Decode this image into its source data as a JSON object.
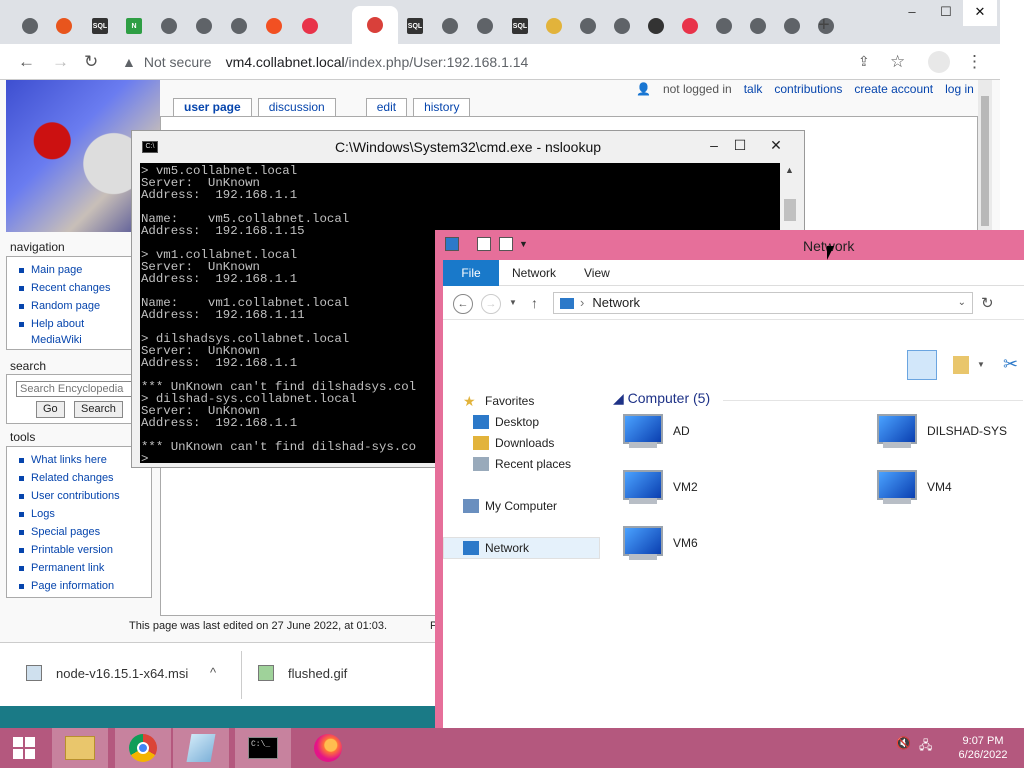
{
  "browser": {
    "tabs": [
      {
        "icon": "chrome-icon",
        "color": "#5f6368"
      },
      {
        "icon": "red-circle-icon",
        "color": "#e8551d"
      },
      {
        "icon": "sql-server-icon",
        "color": "#333333",
        "text": "SQL"
      },
      {
        "icon": "n-icon",
        "color": "#2e9e44",
        "text": "N"
      },
      {
        "icon": "download-icon",
        "color": "#5f6368"
      },
      {
        "icon": "chrome-icon",
        "color": "#5f6368"
      },
      {
        "icon": "chrome-icon",
        "color": "#5f6368"
      },
      {
        "icon": "windows-logo-icon",
        "color": "#f25022"
      },
      {
        "icon": "opera-icon",
        "color": "#e8334a"
      },
      {
        "icon": "calendar-icon",
        "color": "#d9403a"
      },
      {
        "icon": "sql-server-icon",
        "color": "#333333",
        "text": "SQL"
      },
      {
        "icon": "chrome-icon",
        "color": "#5f6368"
      },
      {
        "icon": "diamond-icon",
        "color": "#5f6368"
      },
      {
        "icon": "sql-server-icon",
        "color": "#333333",
        "text": "SQL"
      },
      {
        "icon": "folder-icon",
        "color": "#e2b33b"
      },
      {
        "icon": "gear-icon",
        "color": "#5f6368"
      },
      {
        "icon": "chrome-icon",
        "color": "#5f6368"
      },
      {
        "icon": "wikipedia-icon",
        "color": "#333333"
      },
      {
        "icon": "opera-icon",
        "color": "#e8334a"
      },
      {
        "icon": "chrome-icon",
        "color": "#5f6368"
      },
      {
        "icon": "chrome-icon",
        "color": "#5f6368"
      },
      {
        "icon": "gear-icon",
        "color": "#5f6368"
      },
      {
        "icon": "chrome-icon",
        "color": "#5f6368"
      }
    ],
    "new_tab": "+",
    "window_controls": {
      "minimize": "–",
      "maximize": "☐",
      "close": "✕"
    },
    "address": {
      "security": "Not secure",
      "host": "vm4.collabnet.local",
      "path": "/index.php/User:192.168.1.14"
    }
  },
  "wiki": {
    "personal": [
      "not logged in",
      "talk",
      "contributions",
      "create account",
      "log in"
    ],
    "tabs": [
      "user page",
      "discussion",
      "edit",
      "history"
    ],
    "navigation": {
      "heading": "navigation",
      "items": [
        "Main page",
        "Recent changes",
        "Random page",
        "Help about",
        "MediaWiki"
      ]
    },
    "search": {
      "heading": "search",
      "placeholder": "Search Encyclopedia",
      "go": "Go",
      "search": "Search"
    },
    "tools": {
      "heading": "tools",
      "items": [
        "What links here",
        "Related changes",
        "User contributions",
        "Logs",
        "Special pages",
        "Printable version",
        "Permanent link",
        "Page information"
      ]
    },
    "footer": "This page was last edited on 27 June 2022, at 01:03.",
    "footer_cut": "P"
  },
  "downloads": [
    {
      "name": "node-v16.15.1-x64.msi"
    },
    {
      "name": "flushed.gif"
    }
  ],
  "cmd": {
    "title": "C:\\Windows\\System32\\cmd.exe - nslookup",
    "icon_text": "C:\\",
    "lines": [
      "> vm5.collabnet.local",
      "Server:  UnKnown",
      "Address:  192.168.1.1",
      "",
      "Name:    vm5.collabnet.local",
      "Address:  192.168.1.15",
      "",
      "> vm1.collabnet.local",
      "Server:  UnKnown",
      "Address:  192.168.1.1",
      "",
      "Name:    vm1.collabnet.local",
      "Address:  192.168.1.11",
      "",
      "> dilshadsys.collabnet.local",
      "Server:  UnKnown",
      "Address:  192.168.1.1",
      "",
      "*** UnKnown can't find dilshadsys.col",
      "> dilshad-sys.collabnet.local",
      "Server:  UnKnown",
      "Address:  192.168.1.1",
      "",
      "*** UnKnown can't find dilshad-sys.co",
      ">"
    ]
  },
  "explorer": {
    "title": "Network",
    "ribbon_tabs": [
      "File",
      "Network",
      "View"
    ],
    "address": "Network",
    "nav_pane": {
      "favorites": "Favorites",
      "favorites_items": [
        "Desktop",
        "Downloads",
        "Recent places"
      ],
      "my_computer": "My Computer",
      "network": "Network"
    },
    "group_header": "Computer (5)",
    "computers": [
      "AD",
      "DILSHAD-SYS",
      "VM2",
      "VM4",
      "VM6"
    ]
  },
  "taskbar": {
    "apps": [
      "start-icon",
      "file-explorer-icon",
      "chrome-icon",
      "notepad-icon",
      "cmd-icon",
      "firefox-icon"
    ],
    "clock": {
      "time": "9:07 PM",
      "date": "6/26/2022"
    }
  },
  "colors": {
    "explorer_frame": "#e66f9a",
    "taskbar": "#b4587e",
    "wiki_link": "#0645ad",
    "ribbon_file": "#1979ca"
  }
}
